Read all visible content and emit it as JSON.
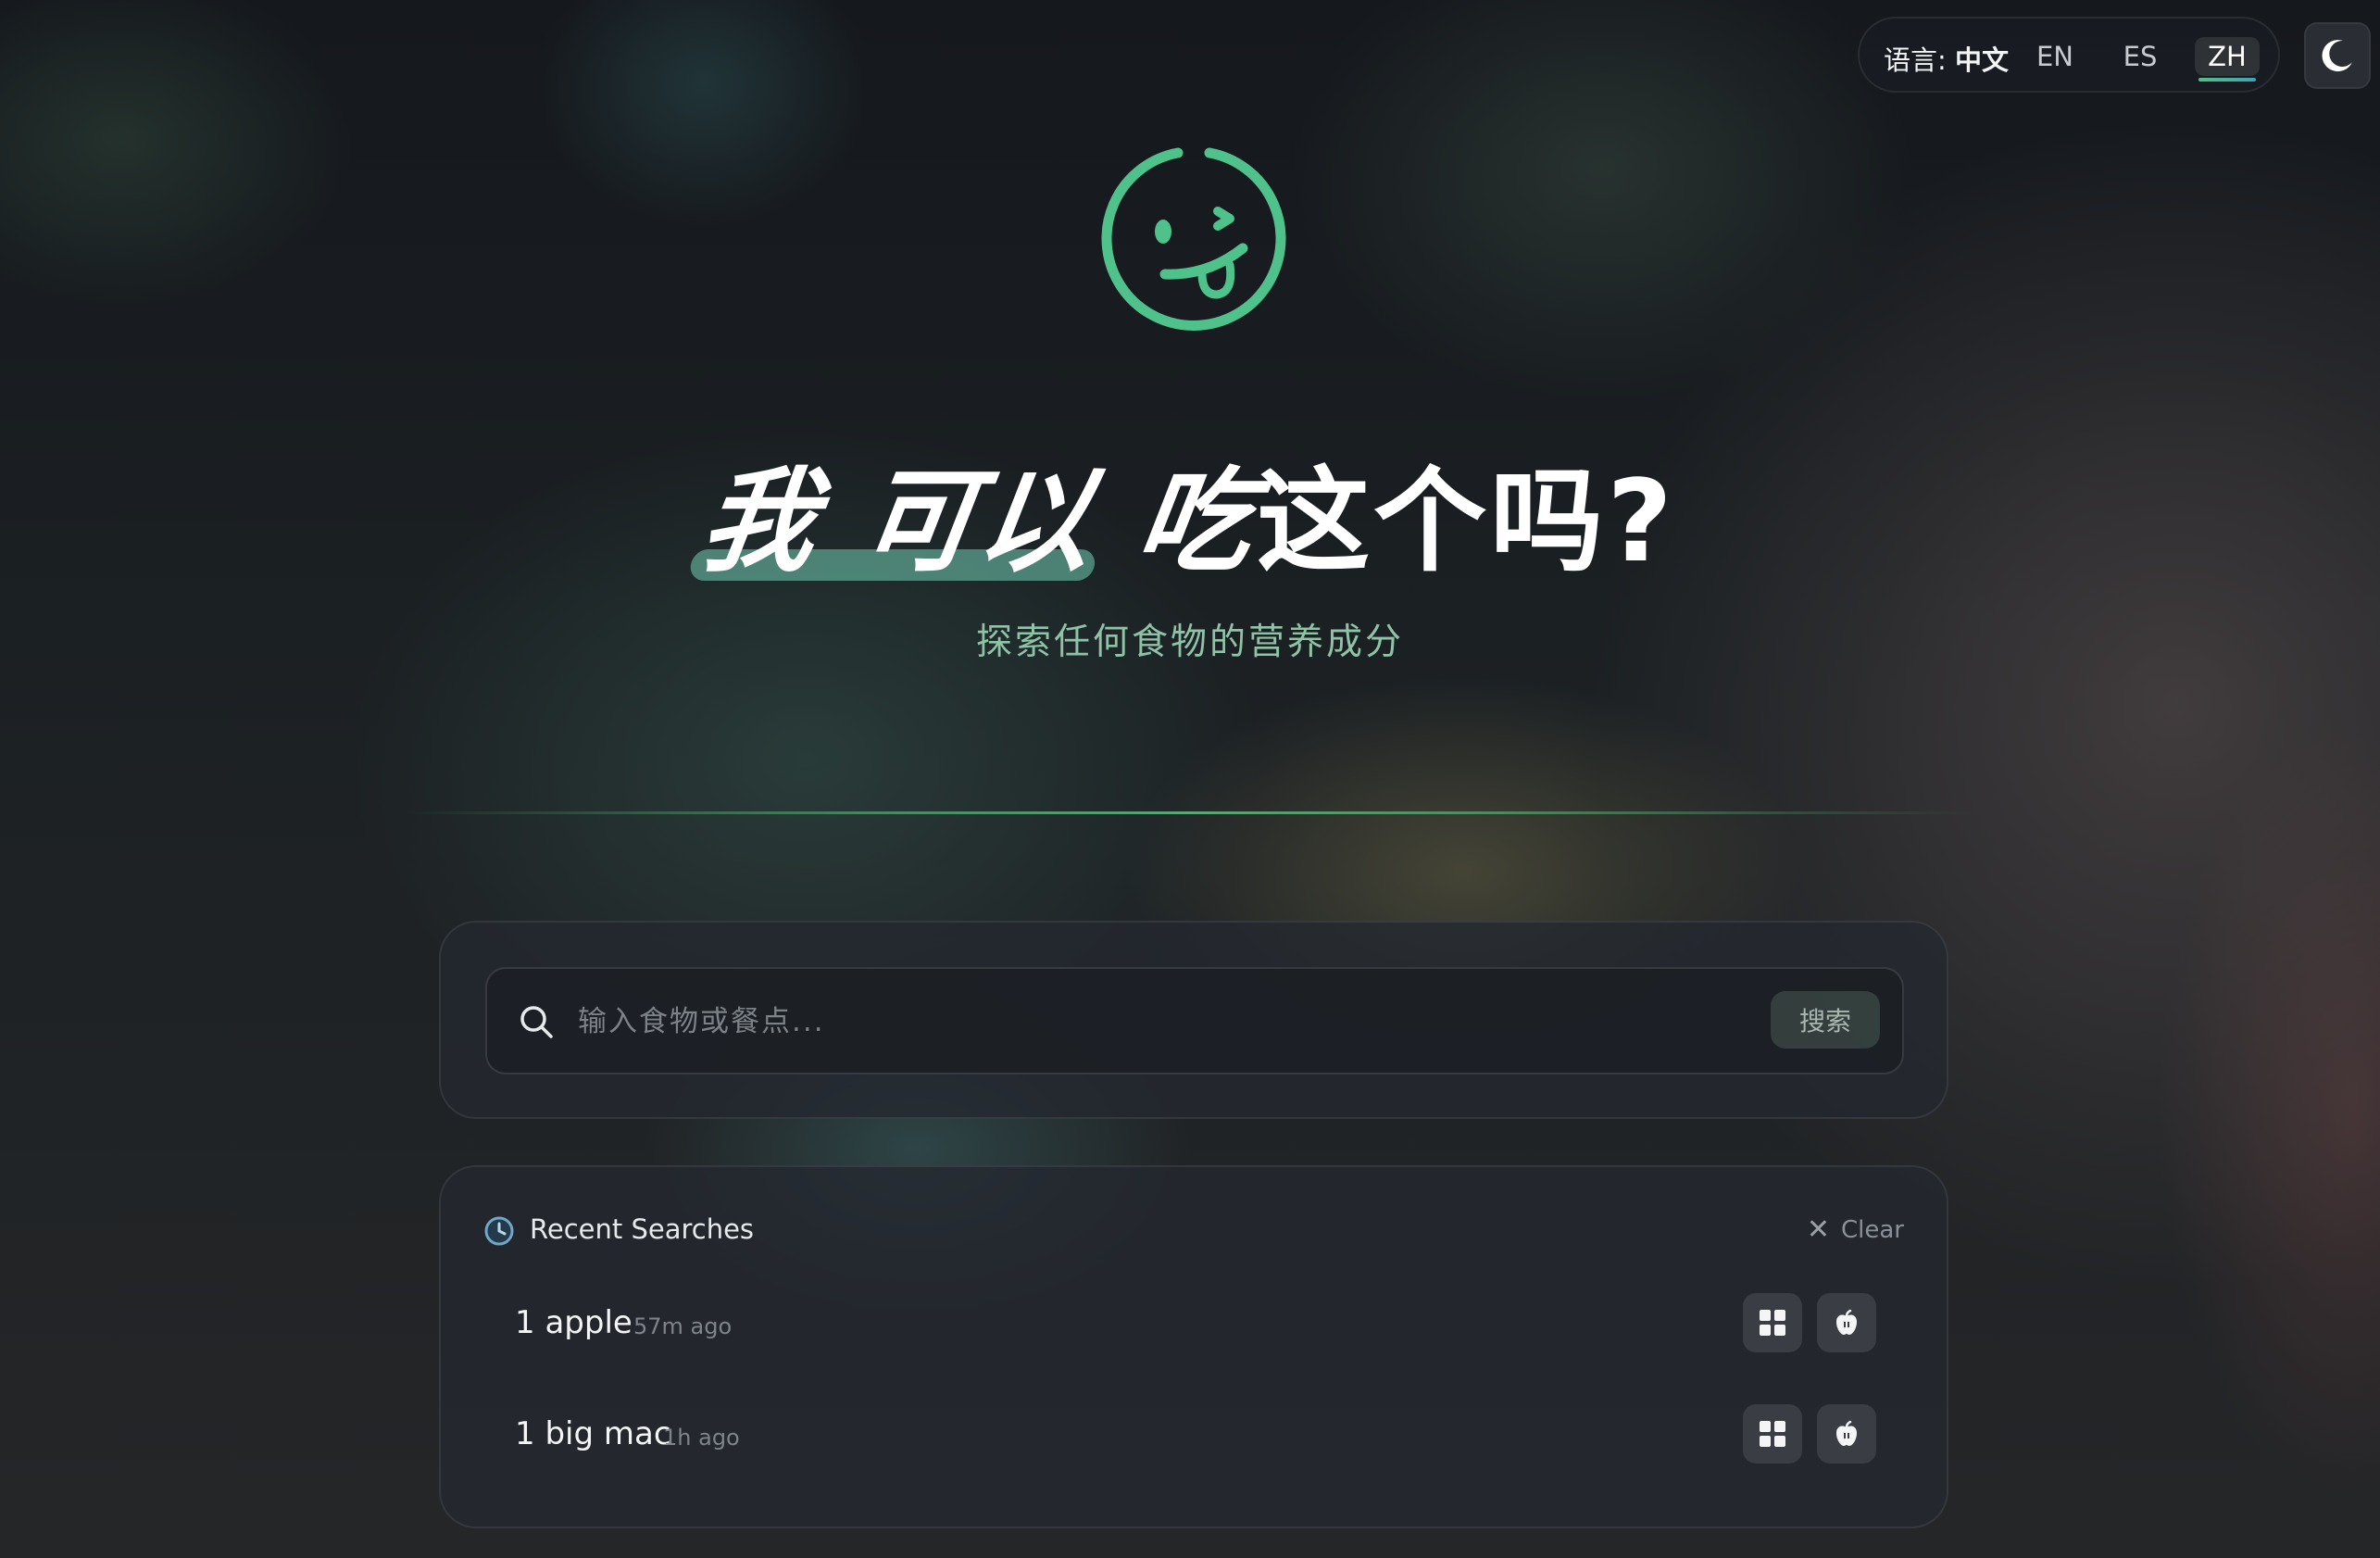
{
  "header": {
    "language_label": "语言:",
    "current_language": "中文",
    "languages": [
      {
        "code": "EN",
        "active": false
      },
      {
        "code": "ES",
        "active": false
      },
      {
        "code": "ZH",
        "active": true
      }
    ],
    "theme_icon": "moon-icon"
  },
  "hero": {
    "logo_icon": "smiley-tongue-icon",
    "title_part1": "我 可以",
    "title_part2": "吃",
    "title_part3": "这个吗",
    "title_mark": "?",
    "subtitle": "探索任何食物的营养成分"
  },
  "search": {
    "placeholder": "输入食物或餐点...",
    "value": "",
    "button_label": "搜索",
    "icon": "search-icon"
  },
  "recent": {
    "title": "Recent Searches",
    "clear_label": "Clear",
    "items": [
      {
        "name": "1 apple",
        "time": "57m ago"
      },
      {
        "name": "1 big mac",
        "time": "1h ago"
      }
    ]
  },
  "colors": {
    "accent": "#4fc18a",
    "accent_teal": "#3aa6b3"
  }
}
